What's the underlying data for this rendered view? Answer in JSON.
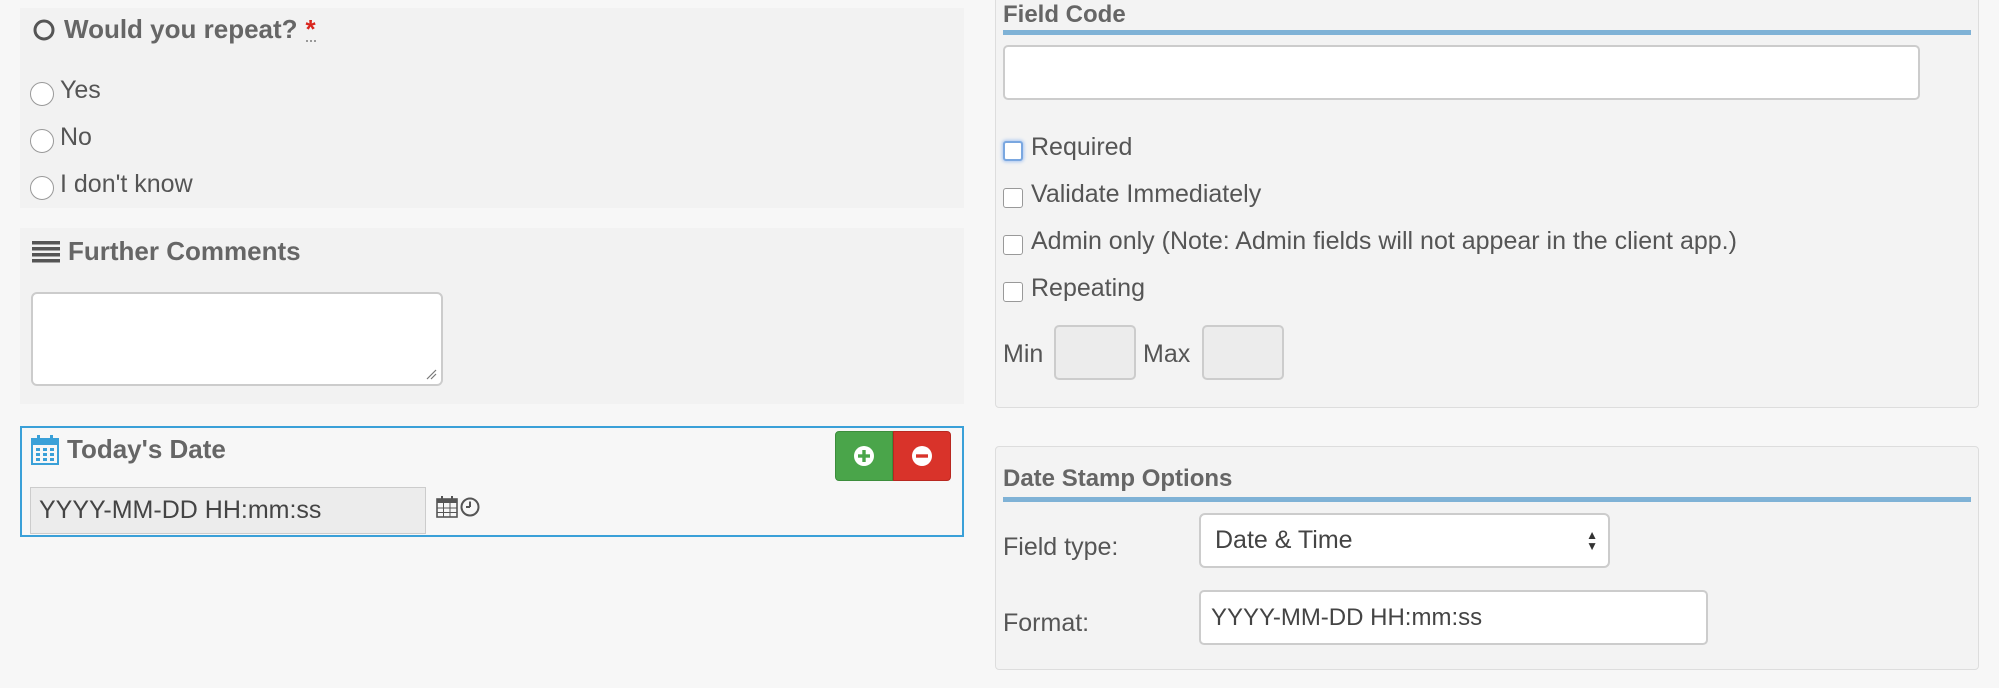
{
  "repeat_question": {
    "title": "Would you repeat?",
    "required_mark": "*",
    "options": [
      "Yes",
      "No",
      "I don't know"
    ]
  },
  "further_comments": {
    "title": "Further Comments",
    "value": ""
  },
  "todays_date": {
    "title": "Today's Date",
    "input_value": "YYYY-MM-DD HH:mm:ss",
    "add_icon": "plus-circle-icon",
    "remove_icon": "minus-circle-icon"
  },
  "field_code_panel": {
    "legend": "Field Code",
    "code_value": "",
    "checks": [
      {
        "label": "Required",
        "checked": false,
        "focused": true
      },
      {
        "label": "Validate Immediately",
        "checked": false
      },
      {
        "label": "Admin only (Note: Admin fields will not appear in the client app.)",
        "checked": false
      },
      {
        "label": "Repeating",
        "checked": false
      }
    ],
    "min_label": "Min",
    "max_label": "Max",
    "min_value": "",
    "max_value": ""
  },
  "date_stamp_panel": {
    "legend": "Date Stamp Options",
    "field_type_label": "Field type:",
    "field_type_value": "Date & Time",
    "format_label": "Format:",
    "format_value": "YYYY-MM-DD HH:mm:ss"
  },
  "colors": {
    "accent_blue": "#3aa0d8",
    "rule_blue": "#7fb2d6",
    "add_green": "#4aa54a",
    "remove_red": "#d9332a",
    "required_red": "#d9251d"
  }
}
